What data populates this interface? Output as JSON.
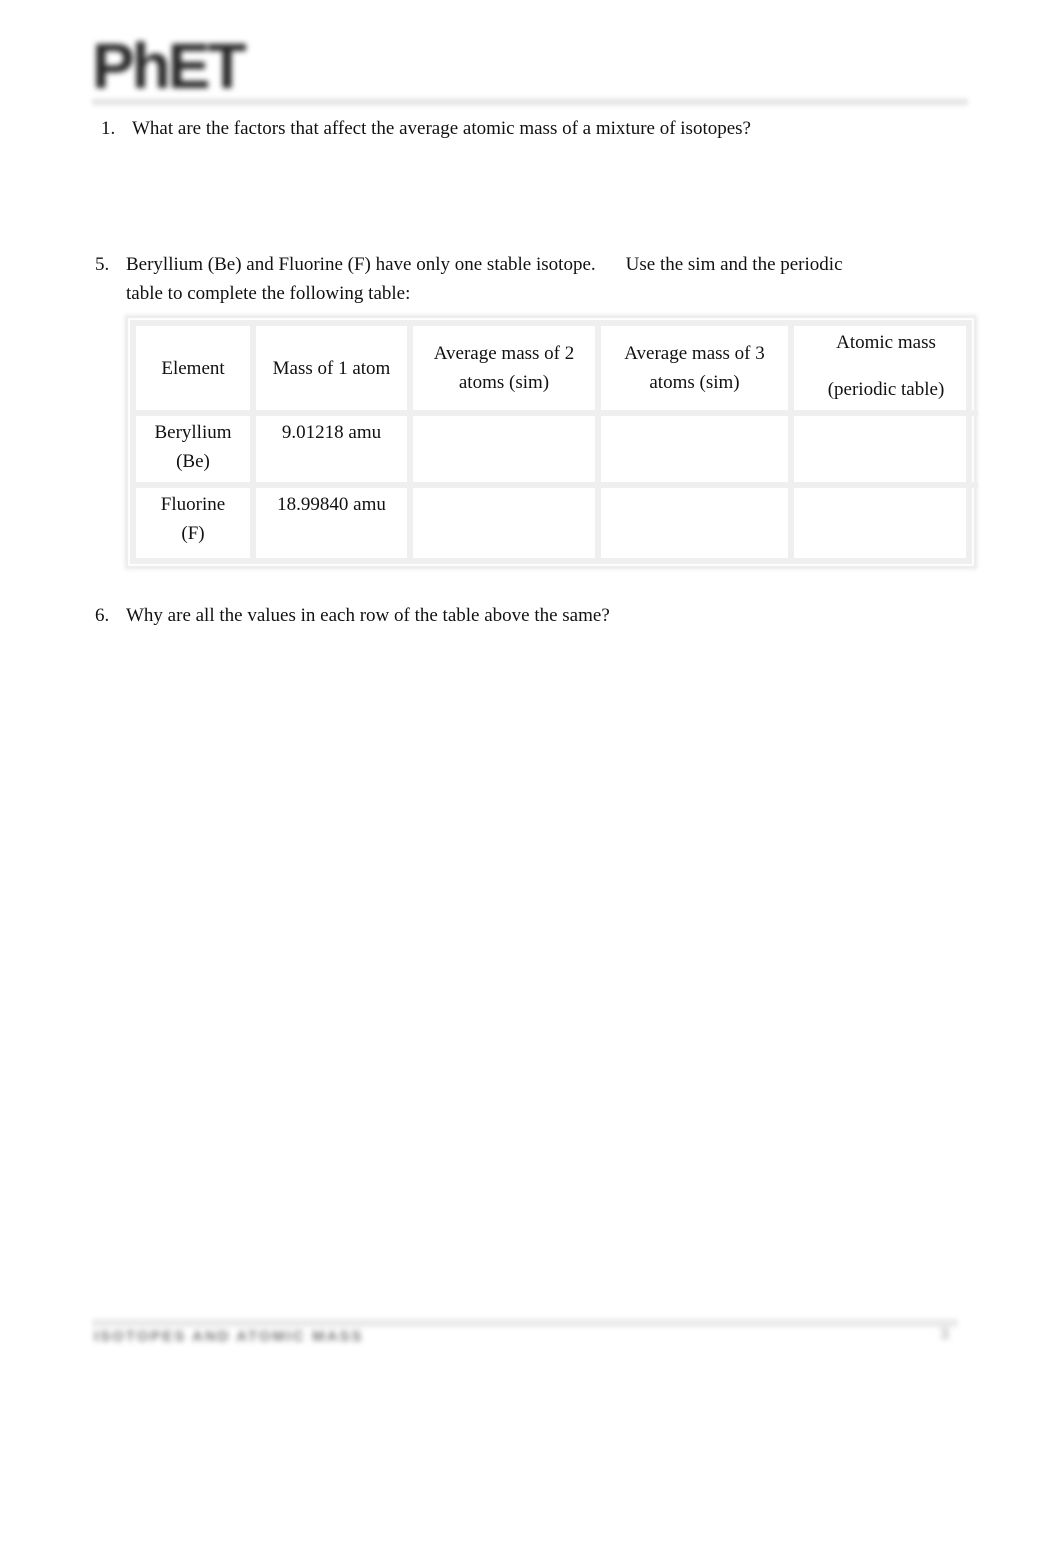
{
  "header": {
    "logo_text": "PhET"
  },
  "questions": {
    "q1": {
      "number": "1.",
      "text": "What are the factors that affect the average atomic mass of a mixture of isotopes?"
    },
    "q5": {
      "number": "5.",
      "text_part1": "Beryllium (Be) and Fluorine (F) have only one stable isotope.",
      "text_part2": "Use the sim and the periodic",
      "text_line2": "table to complete the following table:"
    },
    "q6": {
      "number": "6.",
      "text": "Why are all the values in each row of the table above the same?"
    }
  },
  "table": {
    "headers": {
      "element": "Element",
      "mass1": "Mass of 1 atom",
      "avg2_line1": "Average mass of 2",
      "avg2_line2": "atoms (sim)",
      "avg3_line1": "Average mass of 3",
      "avg3_line2": "atoms (sim)",
      "atomic_line1": "Atomic mass",
      "atomic_line2": "(periodic table)"
    },
    "rows": [
      {
        "element_line1": "Beryllium",
        "element_line2": "(Be)",
        "mass1": "9.01218 amu",
        "avg2": "",
        "avg3": "",
        "atomic": ""
      },
      {
        "element_line1": "Fluorine",
        "element_line2": "(F)",
        "mass1": "18.99840 amu",
        "avg2": "",
        "avg3": "",
        "atomic": ""
      }
    ]
  },
  "footer": {
    "title": "ISOTOPES AND ATOMIC MASS",
    "page_number": "3"
  }
}
